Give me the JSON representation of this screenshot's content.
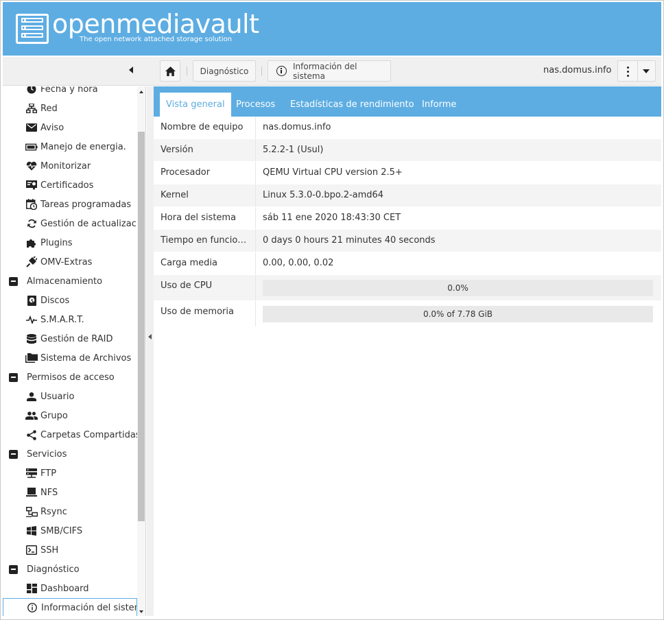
{
  "app": {
    "brand": "openmediavault",
    "tagline": "The open network attached storage solution"
  },
  "toolbar": {
    "breadcrumbs": [
      {
        "label": "Diagnóstico"
      },
      {
        "label": "Información del sistema"
      }
    ],
    "hostname": "nas.domus.info"
  },
  "sidebar": {
    "items": [
      {
        "label": "Fecha y hora",
        "icon": "clock-icon"
      },
      {
        "label": "Red",
        "icon": "network-icon"
      },
      {
        "label": "Aviso",
        "icon": "envelope-icon"
      },
      {
        "label": "Manejo de energia.",
        "icon": "battery-icon"
      },
      {
        "label": "Monitorizar",
        "icon": "heart-pulse-icon"
      },
      {
        "label": "Certificados",
        "icon": "certificate-icon"
      },
      {
        "label": "Tareas programadas",
        "icon": "calendar-clock-icon"
      },
      {
        "label": "Gestión de actualizacio",
        "icon": "refresh-icon"
      },
      {
        "label": "Plugins",
        "icon": "puzzle-icon"
      },
      {
        "label": "OMV-Extras",
        "icon": "plug-icon"
      }
    ],
    "groups": [
      {
        "label": "Almacenamiento",
        "items": [
          {
            "label": "Discos",
            "icon": "disk-icon"
          },
          {
            "label": "S.M.A.R.T.",
            "icon": "pulse-icon"
          },
          {
            "label": "Gestión de RAID",
            "icon": "database-icon"
          },
          {
            "label": "Sistema de Archivos",
            "icon": "folders-icon"
          }
        ]
      },
      {
        "label": "Permisos de acceso",
        "items": [
          {
            "label": "Usuario",
            "icon": "user-icon"
          },
          {
            "label": "Grupo",
            "icon": "group-icon"
          },
          {
            "label": "Carpetas Compartidas",
            "icon": "share-icon"
          }
        ]
      },
      {
        "label": "Servicios",
        "items": [
          {
            "label": "FTP",
            "icon": "server-icon"
          },
          {
            "label": "NFS",
            "icon": "monitor-icon"
          },
          {
            "label": "Rsync",
            "icon": "lan-icon"
          },
          {
            "label": "SMB/CIFS",
            "icon": "windows-icon"
          },
          {
            "label": "SSH",
            "icon": "terminal-icon"
          }
        ]
      },
      {
        "label": "Diagnóstico",
        "items": [
          {
            "label": "Dashboard",
            "icon": "dashboard-icon"
          },
          {
            "label": "Información del sistem",
            "icon": "info-icon",
            "selected": true
          }
        ]
      }
    ]
  },
  "tabs": [
    {
      "label": "Vista general",
      "active": true
    },
    {
      "label": "Procesos"
    },
    {
      "label": "Estadísticas de rendimiento"
    },
    {
      "label": "Informe"
    }
  ],
  "system_info": {
    "rows": [
      {
        "label": "Nombre de equipo",
        "value": "nas.domus.info"
      },
      {
        "label": "Versión",
        "value": "5.2.2-1 (Usul)"
      },
      {
        "label": "Procesador",
        "value": "QEMU Virtual CPU version 2.5+"
      },
      {
        "label": "Kernel",
        "value": "Linux 5.3.0-0.bpo.2-amd64"
      },
      {
        "label": "Hora del sistema",
        "value": "sáb 11 ene 2020 18:43:30 CET"
      },
      {
        "label": "Tiempo en funcion…",
        "value": "0 days 0 hours 21 minutes 40 seconds"
      },
      {
        "label": "Carga media",
        "value": "0.00, 0.00, 0.02"
      }
    ],
    "cpu": {
      "label": "Uso de CPU",
      "text": "0.0%",
      "fraction": 0.0
    },
    "memory": {
      "label": "Uso de memoria",
      "text": "0.0% of 7.78 GiB",
      "fraction": 0.0
    }
  },
  "colors": {
    "accent": "#5dade2",
    "text": "#333333"
  }
}
